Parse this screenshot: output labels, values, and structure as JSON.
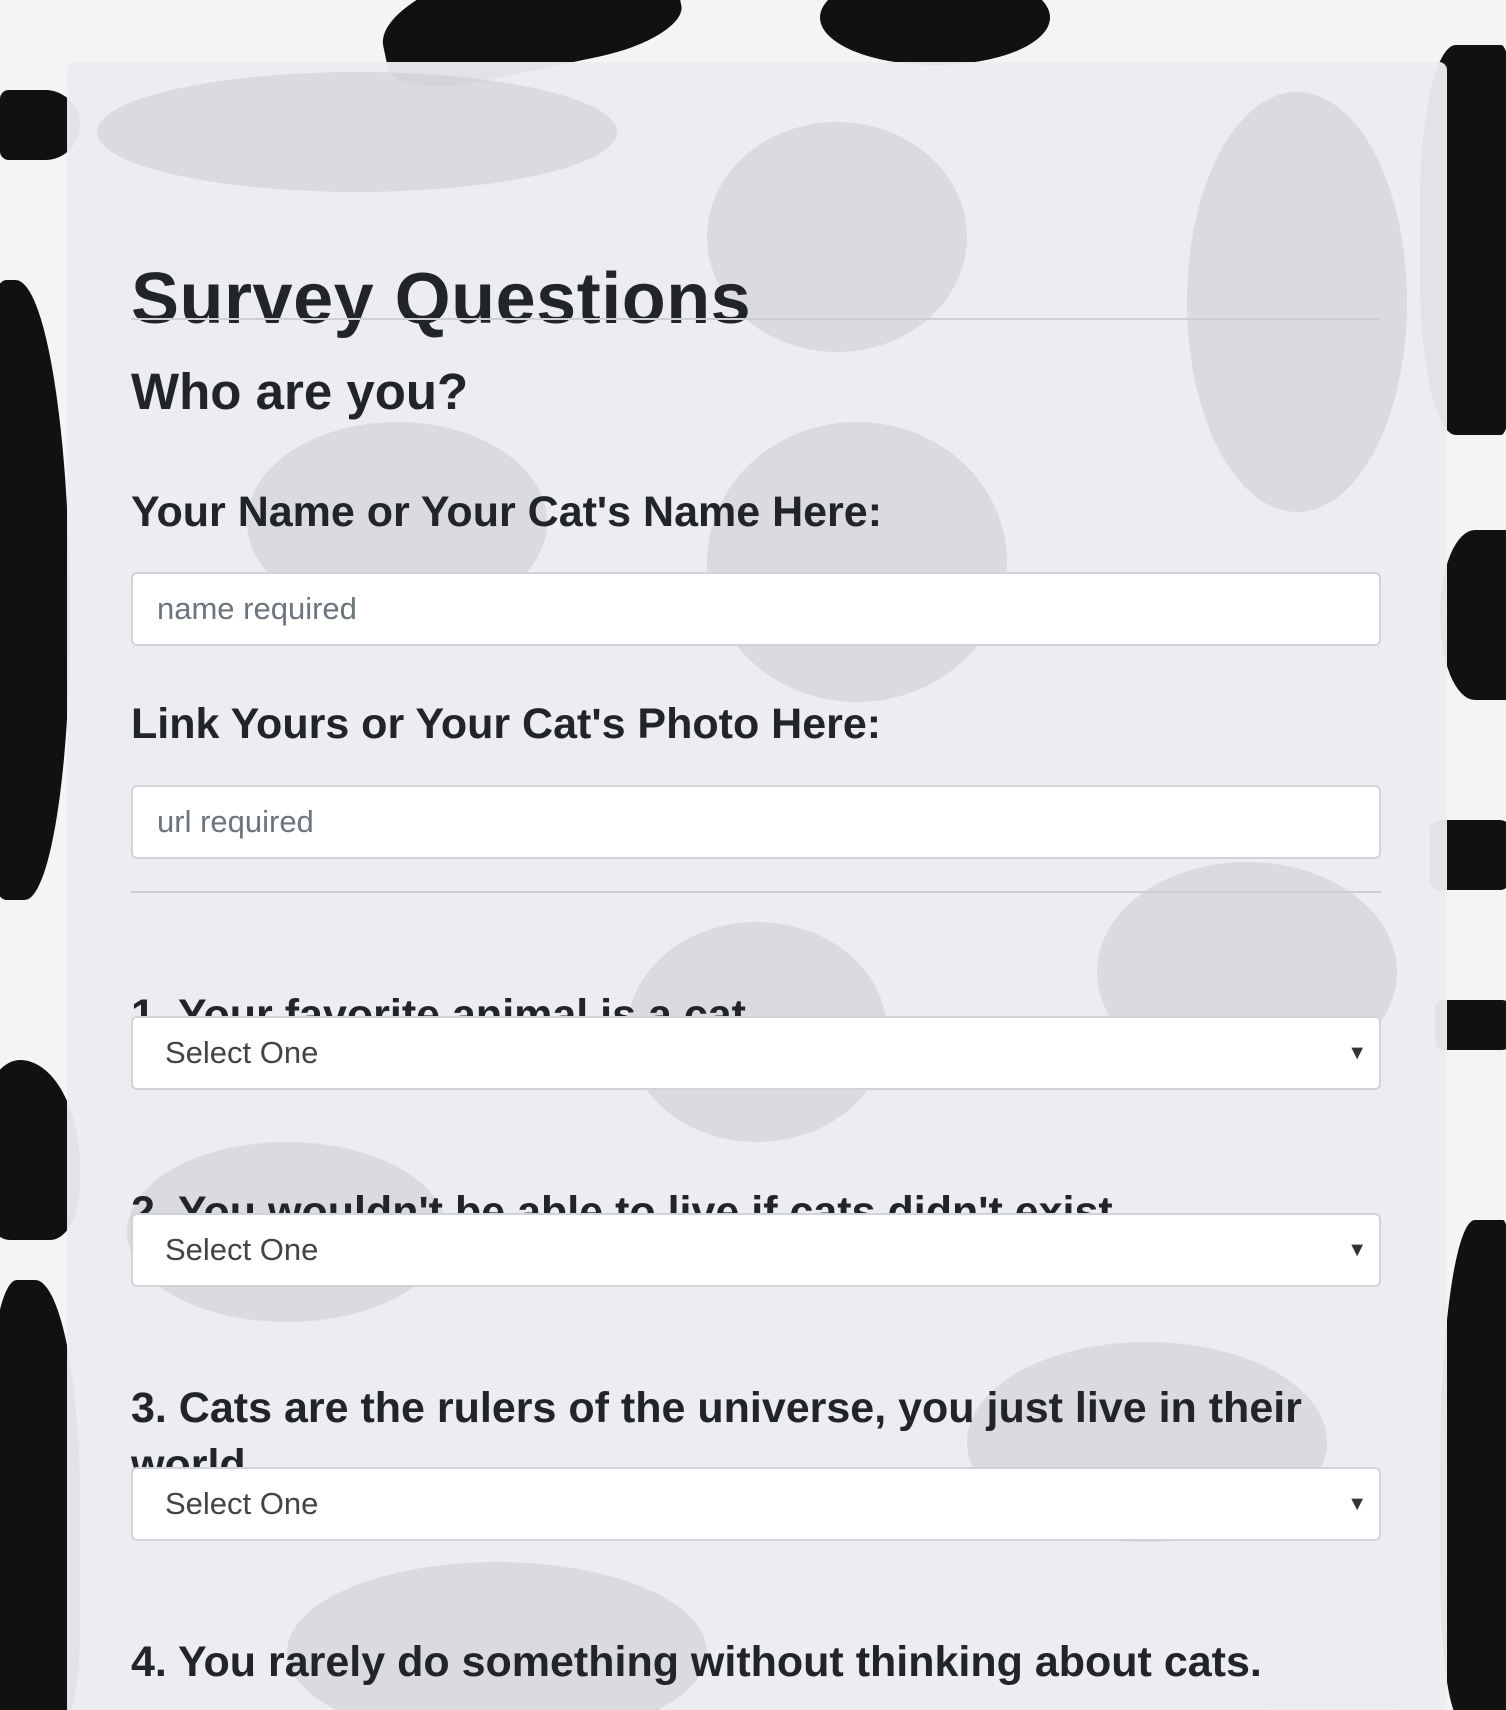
{
  "page": {
    "title": "Survey Questions",
    "section_heading": "Who are you?"
  },
  "fields": {
    "name_label": "Your Name or Your Cat's Name Here:",
    "name_placeholder": "name required",
    "photo_label": "Link Yours or Your Cat's Photo Here:",
    "photo_placeholder": "url required"
  },
  "questions": [
    {
      "label": "1. Your favorite animal is a cat.",
      "selected": "Select One"
    },
    {
      "label": "2. You wouldn't be able to live if cats didn't exist.",
      "selected": "Select One"
    },
    {
      "label": "3. Cats are the rulers of the universe, you just live in their world.",
      "selected": "Select One"
    },
    {
      "label": "4. You rarely do something without thinking about cats."
    }
  ],
  "icons": {
    "dropdown": "chevron-down-icon"
  },
  "colors": {
    "card_background": "#ececf0",
    "text": "#212529",
    "placeholder": "#6c757d",
    "border": "#ced4da"
  }
}
